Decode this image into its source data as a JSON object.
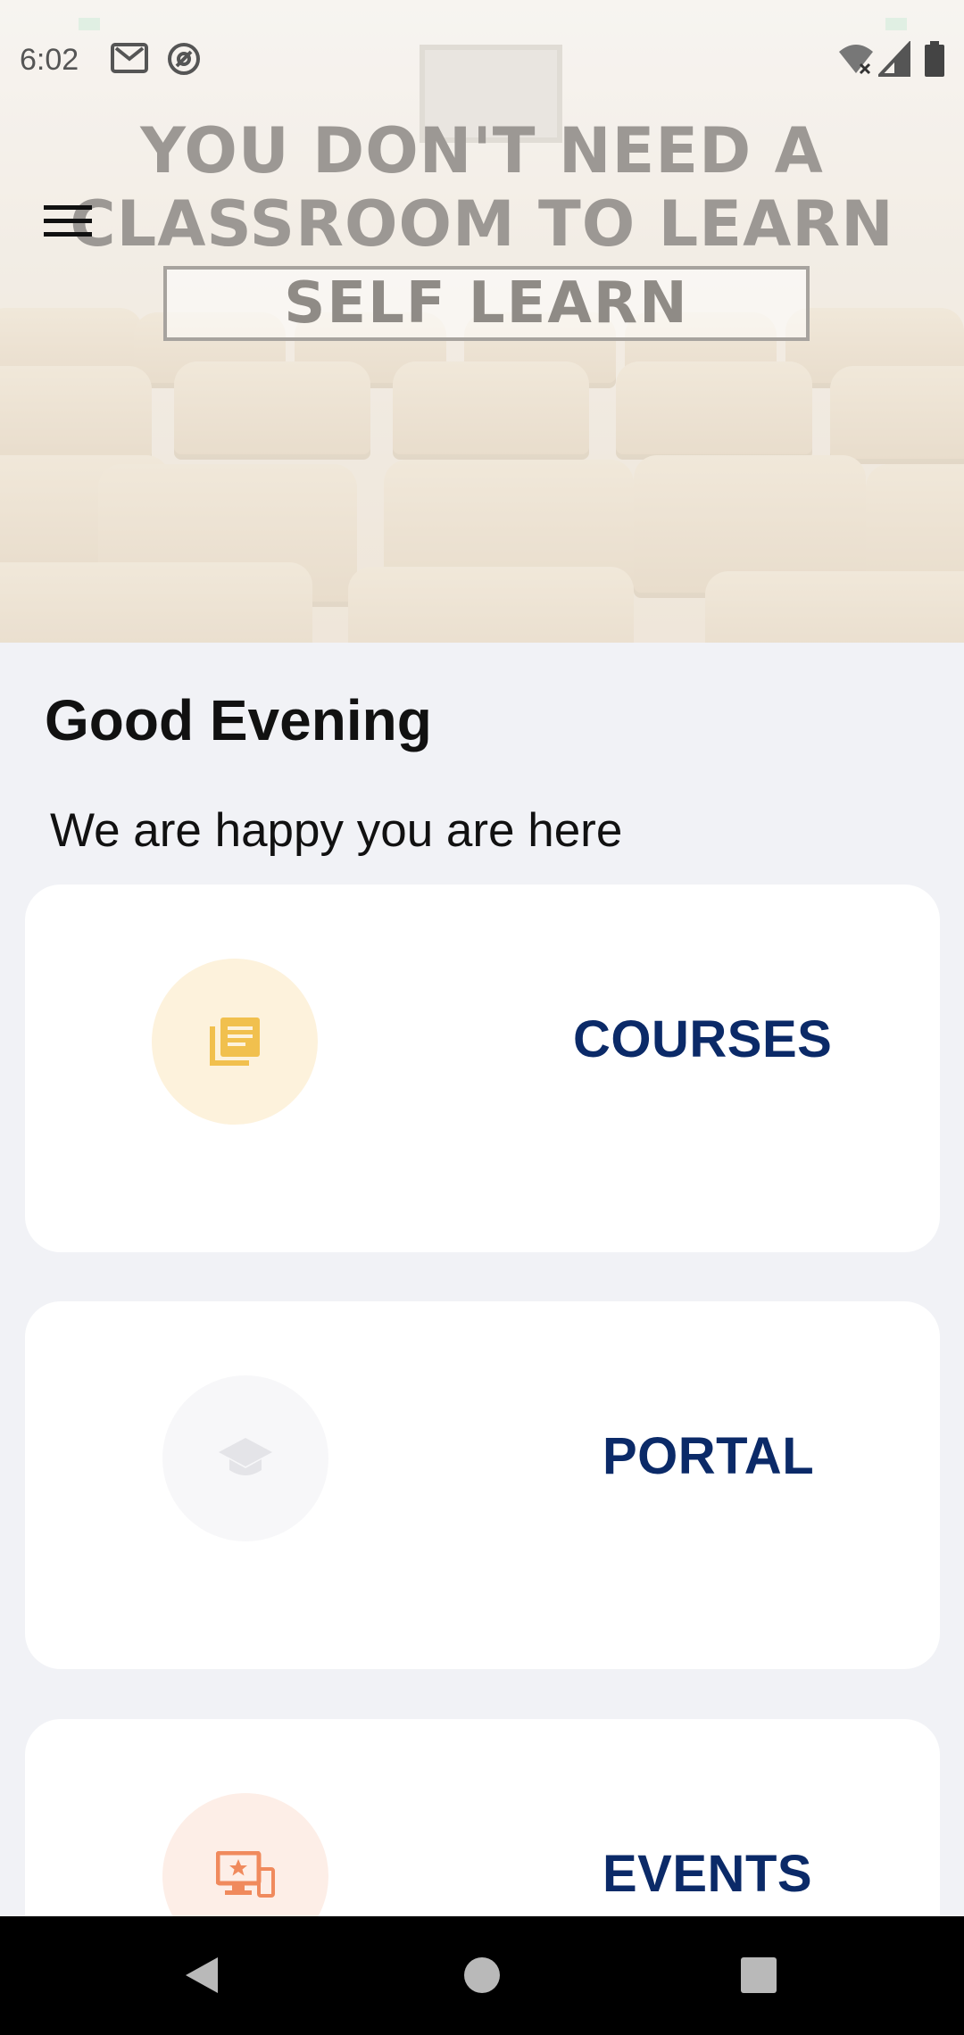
{
  "status_bar": {
    "time": "6:02"
  },
  "hero": {
    "line1": "YOU DON'T NEED A",
    "line2": "CLASSROOM TO LEARN",
    "box_text": "SELF LEARN"
  },
  "greeting": {
    "title": "Good Evening",
    "subtitle": "We are happy you are here"
  },
  "cards": [
    {
      "label": "COURSES",
      "icon": "library-books-icon",
      "icon_color": "#f1c04e",
      "circle_color": "#fdf2dc"
    },
    {
      "label": "PORTAL",
      "icon": "graduation-cap-icon",
      "icon_color": "#e4e4e8",
      "circle_color": "#f7f7f9"
    },
    {
      "label": "EVENTS",
      "icon": "devices-star-icon",
      "icon_color": "#f08a5d",
      "circle_color": "#fdeee7"
    }
  ],
  "colors": {
    "background": "#f1f2f6",
    "card_label": "#0b2a68",
    "nav_bar": "#000000"
  }
}
